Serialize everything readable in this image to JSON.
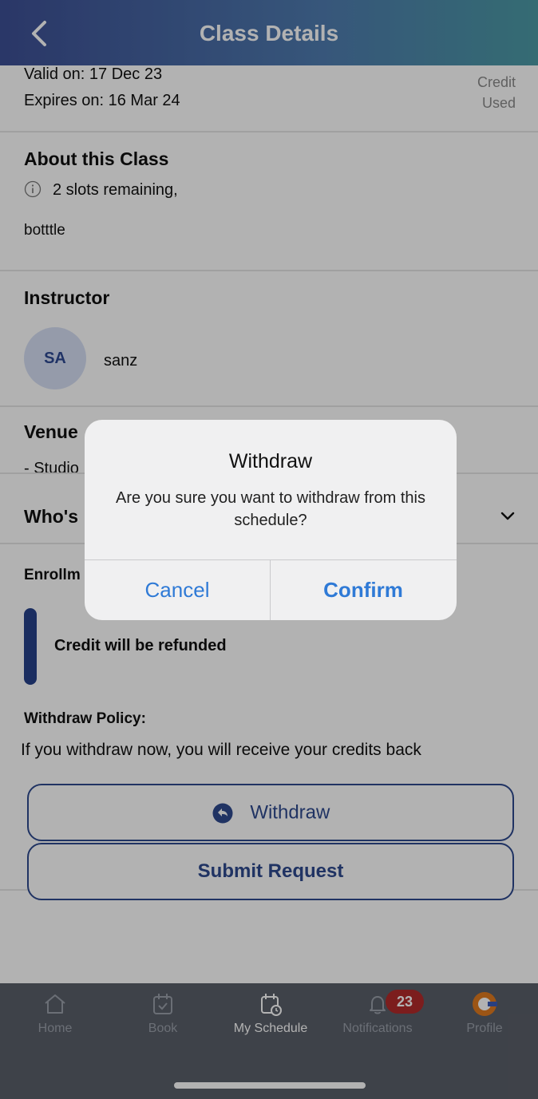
{
  "header": {
    "title": "Class Details"
  },
  "validity": {
    "valid_on": "Valid on: 17 Dec 23",
    "expires_on": "Expires on: 16 Mar 24",
    "credit_label": "Credit",
    "used_label": "Used"
  },
  "about": {
    "title": "About this Class",
    "slots": "2 slots remaining,",
    "description": "botttle"
  },
  "instructor": {
    "title": "Instructor",
    "initials": "SA",
    "name": "sanz"
  },
  "venue": {
    "title": "Venue",
    "value": "- Studio"
  },
  "whos": {
    "title": "Who's"
  },
  "enrollment": {
    "title": "Enrollm",
    "refund_text": "Credit will be refunded"
  },
  "policy": {
    "title": "Withdraw Policy:",
    "text": "If you withdraw now, you will receive your credits back",
    "withdraw_button": "Withdraw"
  },
  "submit_button": "Submit Request",
  "tabs": [
    {
      "label": "Home"
    },
    {
      "label": "Book"
    },
    {
      "label": "My Schedule"
    },
    {
      "label": "Notifications"
    },
    {
      "label": "Profile"
    }
  ],
  "notifications_badge": "23",
  "dialog": {
    "title": "Withdraw",
    "message": "Are you sure you want to withdraw from this schedule?",
    "cancel": "Cancel",
    "confirm": "Confirm"
  },
  "colors": {
    "accent": "#2e4a8f",
    "dialog_button": "#2f7ad6",
    "badge": "#b22a2a"
  }
}
